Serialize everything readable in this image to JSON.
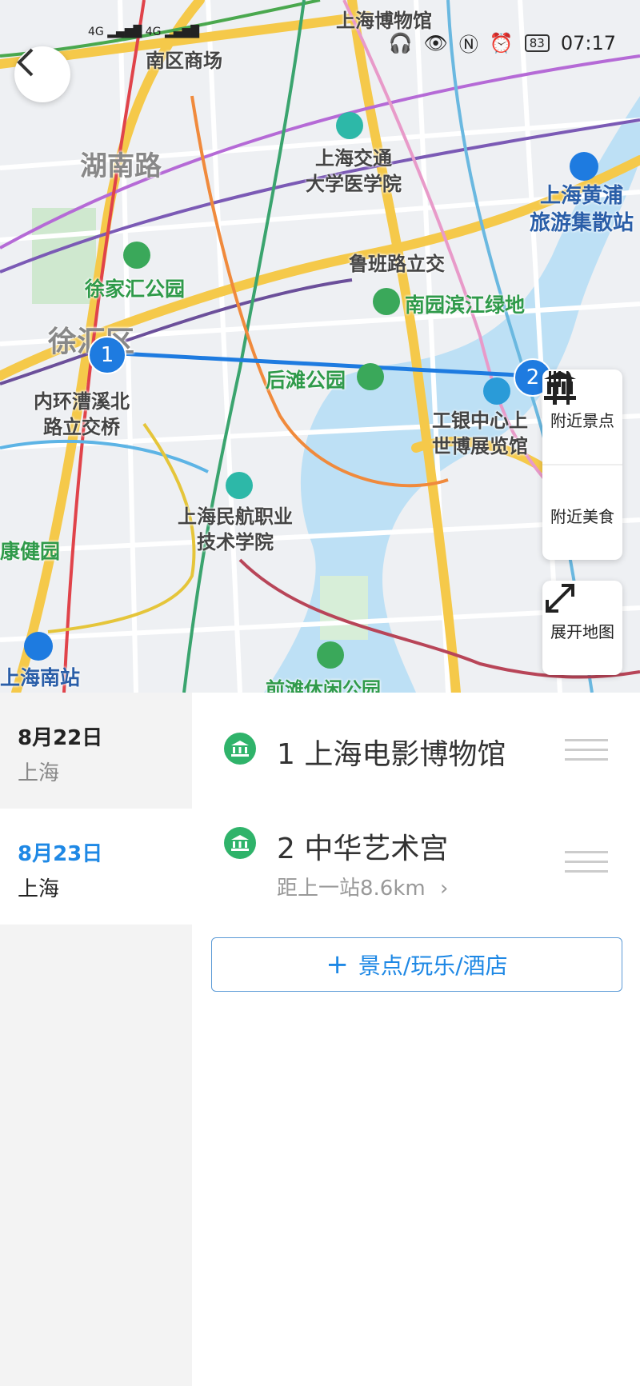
{
  "status_bar": {
    "signal_left": "4G",
    "signal_right": "4G",
    "battery": "83",
    "time": "07:17"
  },
  "map": {
    "labels": [
      {
        "text": "上海博物馆",
        "style": "dark"
      },
      {
        "text": "南区商场",
        "style": "dark"
      },
      {
        "text": "湖南路",
        "style": "gray"
      },
      {
        "text": "上海交通大学医学院",
        "line1": "上海交通",
        "line2": "大学医学院",
        "style": "dark"
      },
      {
        "text": "上海黄浦旅游集散站",
        "line1": "上海黄浦",
        "line2": "旅游集散站",
        "style": "blue"
      },
      {
        "text": "徐家汇公园",
        "style": "green"
      },
      {
        "text": "鲁班路立交",
        "style": "dark"
      },
      {
        "text": "南园滨江绿地",
        "style": "green"
      },
      {
        "text": "徐汇区",
        "style": "gray"
      },
      {
        "text": "后滩公园",
        "style": "green"
      },
      {
        "text": "内环漕溪北路立交桥",
        "line1": "内环漕溪北",
        "line2": "路立交桥",
        "style": "dark"
      },
      {
        "text": "工银中心上世博展览馆",
        "line1": "工银中心上",
        "line2": "世博展览馆",
        "style": "dark"
      },
      {
        "text": "上海民航职业技术学院",
        "line1": "上海民航职业",
        "line2": "技术学院",
        "style": "dark"
      },
      {
        "text": "康健园",
        "style": "green"
      },
      {
        "text": "上海南站",
        "style": "blue"
      },
      {
        "text": "前滩休闲公园",
        "style": "green"
      }
    ],
    "markers": [
      "1",
      "2"
    ],
    "buttons": {
      "nearby_sights": "附近景点",
      "nearby_food": "附近美食",
      "expand_map": "展开地图"
    }
  },
  "days": [
    {
      "date": "8月22日",
      "city": "上海",
      "active": false
    },
    {
      "date": "8月23日",
      "city": "上海",
      "active": true
    }
  ],
  "pois": [
    {
      "name": "1 上海电影博物馆",
      "distance": ""
    },
    {
      "name": "2 中华艺术宫",
      "distance": "距上一站8.6km"
    }
  ],
  "add_button": {
    "plus": "+",
    "label": "景点/玩乐/酒店"
  },
  "colors": {
    "accent": "#1e88e5",
    "poi_icon": "#2fb36a",
    "park_label": "#2f9a4a"
  }
}
